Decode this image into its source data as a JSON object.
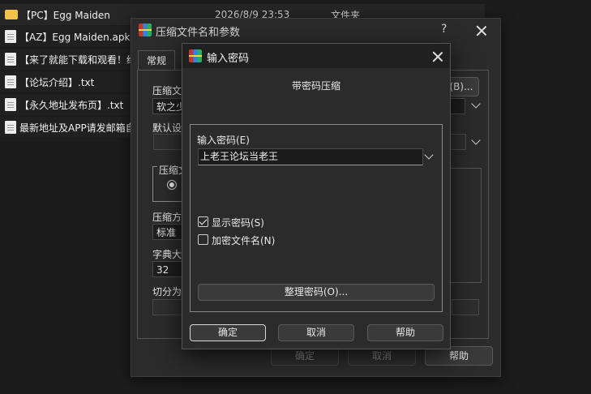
{
  "file_list": [
    {
      "name": "【PC】Egg Maiden",
      "date": "2026/8/9 23:53",
      "type": "文件夹",
      "icon": "folder-icon"
    },
    {
      "name": "【AZ】Egg Maiden.apk",
      "date": "",
      "type": "",
      "icon": "document-icon"
    },
    {
      "name": "【来了就能下载和观看！给",
      "date": "",
      "type": "",
      "icon": "document-icon"
    },
    {
      "name": "【论坛介绍】.txt",
      "date": "",
      "type": "",
      "icon": "document-icon"
    },
    {
      "name": "【永久地址发布页】.txt",
      "date": "",
      "type": "",
      "icon": "document-icon"
    },
    {
      "name": "最新地址及APP请发邮箱自",
      "date": "",
      "type": "",
      "icon": "document-icon"
    }
  ],
  "back_dialog": {
    "title": "压缩文件名和参数",
    "help_glyph": "?",
    "tabs": [
      "常规"
    ],
    "labels": {
      "archive_name": "压缩文",
      "default_settings": "默认设",
      "format_group": "压缩文",
      "method": "压缩方",
      "dictionary": "字典大",
      "split": "切分为"
    },
    "archive_name_value": "软之少",
    "method_value": "标准",
    "dictionary_value": "32",
    "browse_label": "(B)...",
    "ok_label": "确定",
    "cancel_label": "取消",
    "help_label": "帮助"
  },
  "password_dialog": {
    "title": "输入密码",
    "subtitle": "带密码压缩",
    "password_label": "输入密码(E)",
    "password_value": "上老王论坛当老王",
    "show_password_label": "显示密码(S)",
    "show_password_checked": true,
    "encrypt_names_label": "加密文件名(N)",
    "encrypt_names_checked": false,
    "organize_label": "整理密码(O)...",
    "ok_label": "确定",
    "cancel_label": "取消",
    "help_label": "帮助"
  }
}
